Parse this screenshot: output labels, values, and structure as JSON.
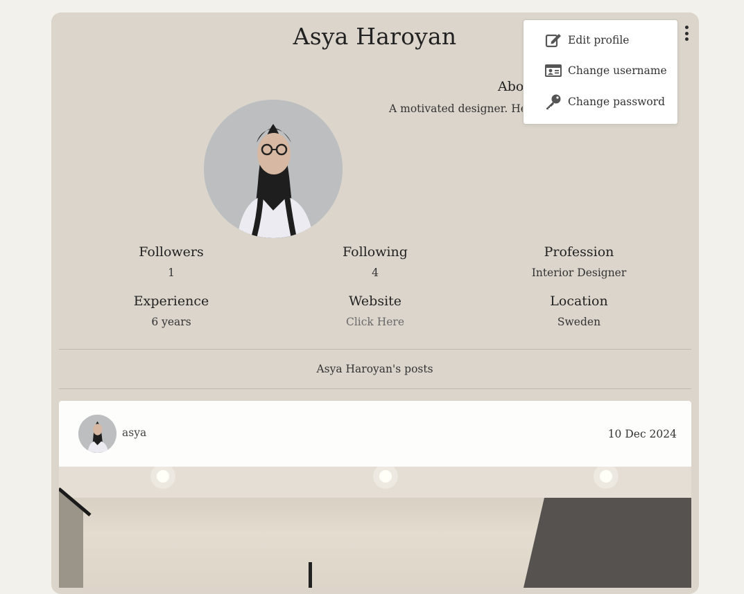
{
  "profile": {
    "name": "Asya Haroyan",
    "about_title": "About",
    "about_text": "A motivated designer. Here"
  },
  "stats": [
    {
      "label": "Followers",
      "value": "1"
    },
    {
      "label": "Following",
      "value": "4"
    },
    {
      "label": "Profession",
      "value": "Interior Designer"
    },
    {
      "label": "Experience",
      "value": "6 years"
    },
    {
      "label": "Website",
      "value": "Click Here"
    },
    {
      "label": "Location",
      "value": "Sweden"
    }
  ],
  "posts_heading": "Asya Haroyan's posts",
  "post": {
    "username": "asya",
    "date": "10 Dec 2024"
  },
  "menu": {
    "items": [
      {
        "label": "Edit profile",
        "icon": "edit-icon"
      },
      {
        "label": "Change username",
        "icon": "id-card-icon"
      },
      {
        "label": "Change password",
        "icon": "key-icon"
      }
    ]
  },
  "colors": {
    "page_bg": "#f3f1ec",
    "card_bg": "#dbd5cb",
    "text": "#2b2b2b",
    "link": "#6a6a6a"
  }
}
